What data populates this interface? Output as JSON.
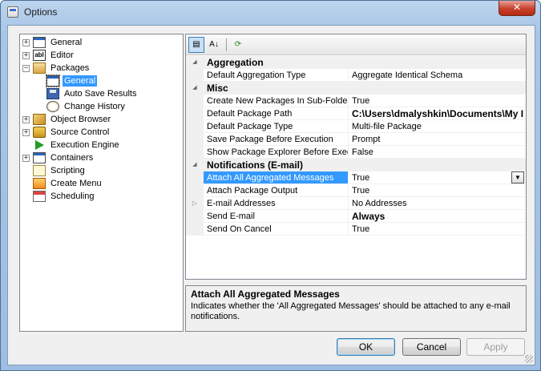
{
  "window": {
    "title": "Options",
    "close_symbol": "✕"
  },
  "tree": {
    "items": [
      {
        "label": "General",
        "expander": "+",
        "icon": "window-icon",
        "level": 0
      },
      {
        "label": "Editor",
        "expander": "+",
        "icon": "abl-editor-icon",
        "level": 0
      },
      {
        "label": "Packages",
        "expander": "−",
        "icon": "package-icon",
        "level": 0
      },
      {
        "label": "General",
        "expander": "",
        "icon": "window-icon",
        "level": 1,
        "selected": true
      },
      {
        "label": "Auto Save Results",
        "expander": "",
        "icon": "floppy-disk-icon",
        "level": 1
      },
      {
        "label": "Change History",
        "expander": "",
        "icon": "history-clock-icon",
        "level": 1
      },
      {
        "label": "Object Browser",
        "expander": "+",
        "icon": "object-browser-icon",
        "level": 0
      },
      {
        "label": "Source Control",
        "expander": "+",
        "icon": "lock-icon",
        "level": 0
      },
      {
        "label": "Execution Engine",
        "expander": "",
        "icon": "execute-arrow-icon",
        "level": 0
      },
      {
        "label": "Containers",
        "expander": "+",
        "icon": "container-icon",
        "level": 0
      },
      {
        "label": "Scripting",
        "expander": "",
        "icon": "script-icon",
        "level": 0
      },
      {
        "label": "Create Menu",
        "expander": "",
        "icon": "create-menu-icon",
        "level": 0
      },
      {
        "label": "Scheduling",
        "expander": "",
        "icon": "calendar-icon",
        "level": 0
      }
    ]
  },
  "toolbar": {
    "categorized_label": "▤",
    "alphabetical_label": "A↓",
    "refresh_label": "⟳"
  },
  "grid": {
    "rows": [
      {
        "type": "category",
        "label": "Aggregation"
      },
      {
        "type": "property",
        "name": "Default Aggregation Type",
        "value": "Aggregate Identical Schema"
      },
      {
        "type": "category",
        "label": "Misc"
      },
      {
        "type": "property",
        "name": "Create New Packages In Sub-Folder",
        "value": "True"
      },
      {
        "type": "property",
        "name": "Default Package Path",
        "value": "C:\\Users\\dmalyshkin\\Documents\\My I",
        "bold": true
      },
      {
        "type": "property",
        "name": "Default Package Type",
        "value": "Multi-file Package"
      },
      {
        "type": "property",
        "name": "Save Package Before Execution",
        "value": "Prompt"
      },
      {
        "type": "property",
        "name": "Show Package Explorer Before Execu",
        "value": "False"
      },
      {
        "type": "category",
        "label": "Notifications (E-mail)"
      },
      {
        "type": "property",
        "name": "Attach All Aggregated Messages",
        "value": "True",
        "selected": true,
        "dropdown": true
      },
      {
        "type": "property",
        "name": "Attach Package Output",
        "value": "True"
      },
      {
        "type": "property",
        "name": "E-mail Addresses",
        "value": "No Addresses",
        "expandable": true
      },
      {
        "type": "property",
        "name": "Send E-mail",
        "value": "Always",
        "bold": true
      },
      {
        "type": "property",
        "name": "Send On Cancel",
        "value": "True"
      }
    ]
  },
  "description": {
    "title": "Attach All Aggregated Messages",
    "text": "Indicates whether the 'All Aggregated Messages' should be attached to any e-mail notifications."
  },
  "buttons": {
    "ok": "OK",
    "cancel": "Cancel",
    "apply": "Apply"
  }
}
